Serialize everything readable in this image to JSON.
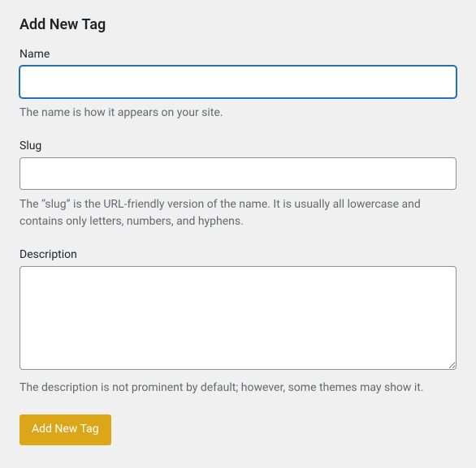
{
  "heading": "Add New Tag",
  "fields": {
    "name": {
      "label": "Name",
      "value": "",
      "description": "The name is how it appears on your site."
    },
    "slug": {
      "label": "Slug",
      "value": "",
      "description": "The “slug” is the URL-friendly version of the name. It is usually all lowercase and contains only letters, numbers, and hyphens."
    },
    "description": {
      "label": "Description",
      "value": "",
      "description": "The description is not prominent by default; however, some themes may show it."
    }
  },
  "submit": {
    "label": "Add New Tag"
  }
}
